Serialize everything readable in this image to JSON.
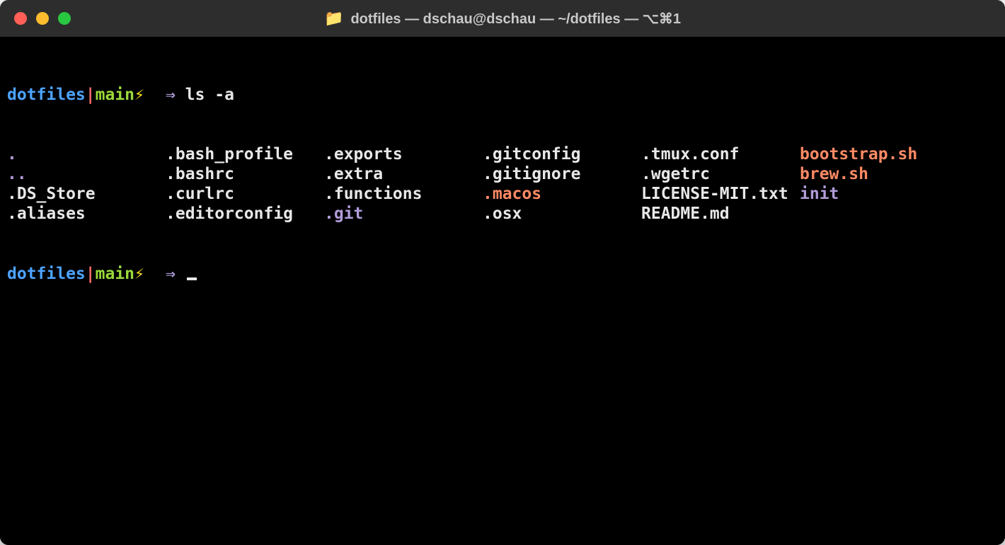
{
  "window": {
    "title": "dotfiles — dschau@dschau — ~/dotfiles — ⌥⌘1",
    "folder_icon": "📁"
  },
  "colors": {
    "traffic_red": "#ff5f57",
    "traffic_yellow": "#febc2e",
    "traffic_green": "#28c840",
    "prompt_dir": "#4da3ff",
    "prompt_sep": "#ff6b6b",
    "prompt_branch": "#9bd93a",
    "prompt_lightning": "#f7e018",
    "prompt_arrow": "#b19cd9",
    "file_dir": "#b19cd9",
    "file_exec": "#ff8a65"
  },
  "prompt": {
    "dir": "dotfiles",
    "sep": "|",
    "branch": "main",
    "lightning": "⚡",
    "arrow": "⇒"
  },
  "command": "ls -a",
  "ls_columns": [
    [
      {
        "name": ".",
        "type": "dir"
      },
      {
        "name": "..",
        "type": "dir"
      },
      {
        "name": ".DS_Store",
        "type": "default"
      },
      {
        "name": ".aliases",
        "type": "default"
      }
    ],
    [
      {
        "name": ".bash_profile",
        "type": "default"
      },
      {
        "name": ".bashrc",
        "type": "default"
      },
      {
        "name": ".curlrc",
        "type": "default"
      },
      {
        "name": ".editorconfig",
        "type": "default"
      }
    ],
    [
      {
        "name": ".exports",
        "type": "default"
      },
      {
        "name": ".extra",
        "type": "default"
      },
      {
        "name": ".functions",
        "type": "default"
      },
      {
        "name": ".git",
        "type": "dir"
      }
    ],
    [
      {
        "name": ".gitconfig",
        "type": "default"
      },
      {
        "name": ".gitignore",
        "type": "default"
      },
      {
        "name": ".macos",
        "type": "exec"
      },
      {
        "name": ".osx",
        "type": "default"
      }
    ],
    [
      {
        "name": ".tmux.conf",
        "type": "default"
      },
      {
        "name": ".wgetrc",
        "type": "default"
      },
      {
        "name": "LICENSE-MIT.txt",
        "type": "default"
      },
      {
        "name": "README.md",
        "type": "default"
      }
    ],
    [
      {
        "name": "bootstrap.sh",
        "type": "exec"
      },
      {
        "name": "brew.sh",
        "type": "exec"
      },
      {
        "name": "init",
        "type": "dir"
      },
      {
        "name": "",
        "type": "default"
      }
    ]
  ]
}
